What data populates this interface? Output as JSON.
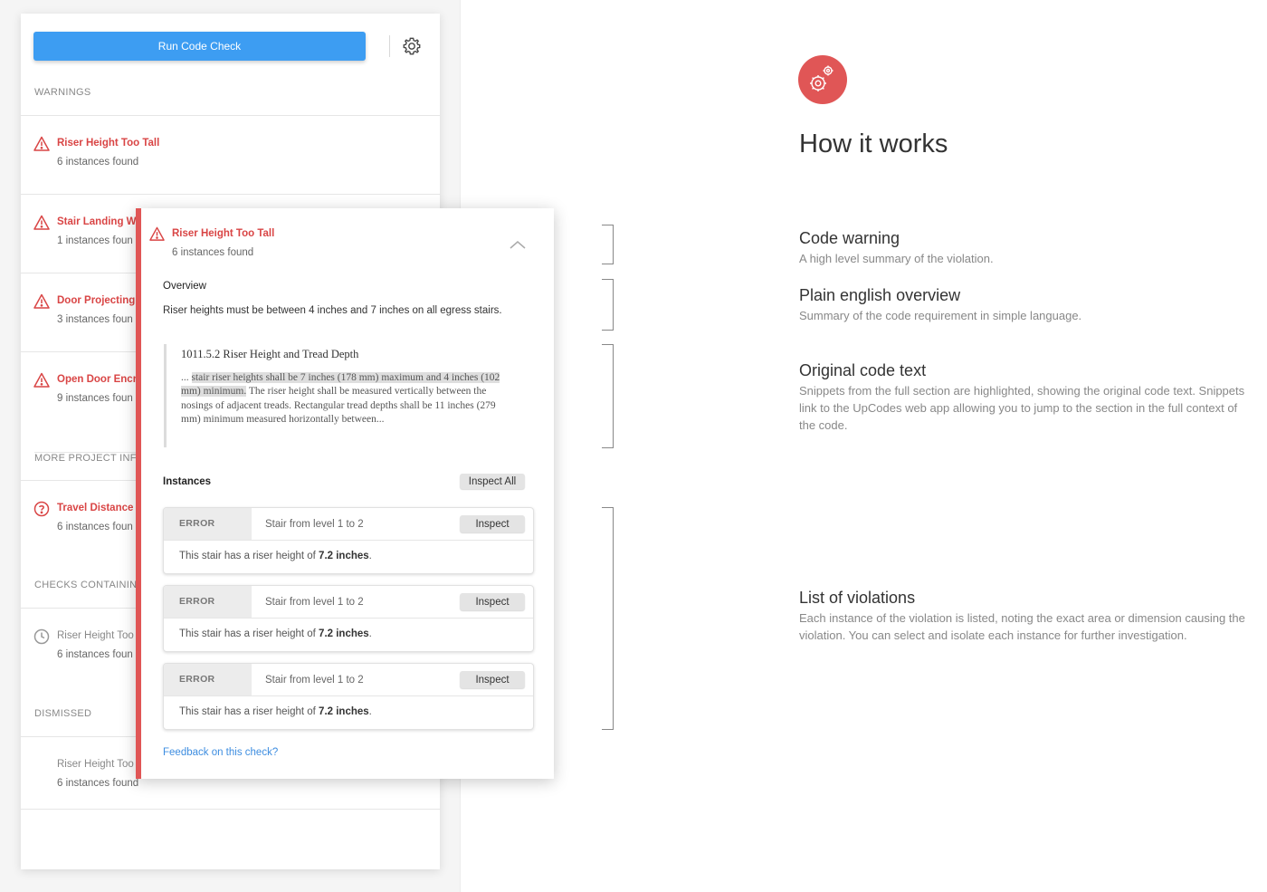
{
  "panel": {
    "run_button": "Run Code Check",
    "warnings_header": "WARNINGS",
    "warnings": [
      {
        "title": "Riser Height Too Tall",
        "count": "6 instances found"
      },
      {
        "title": "Stair Landing Wi",
        "count": "1 instances foun"
      },
      {
        "title": "Door Projecting",
        "count": "3 instances foun"
      },
      {
        "title": "Open Door Encro",
        "count": "9 instances foun"
      }
    ],
    "more_info_header": "MORE PROJECT INFO",
    "more_info_item": {
      "title": "Travel Distance",
      "count": "6 instances foun"
    },
    "checks_header": "CHECKS CONTAINING",
    "checks_item": {
      "title": "Riser Height Too",
      "count": "6 instances foun"
    },
    "dismissed_header": "DISMISSED",
    "dismissed_item": {
      "title": "Riser Height Too",
      "count": "6 instances found"
    }
  },
  "detail": {
    "title": "Riser Height Too Tall",
    "count": "6 instances found",
    "overview_label": "Overview",
    "overview_text": "Riser heights must be between 4 inches and 7 inches on all egress stairs.",
    "code_title": "1011.5.2 Riser Height and Tread Depth",
    "code_prefix": "... ",
    "code_highlight": "stair riser heights shall be 7 inches (178 mm) maximum and 4 inches (102 mm) minimum.",
    "code_rest": " The riser height shall be measured vertically between the nosings of adjacent treads. Rectangular tread depths shall be 11 inches (279 mm) minimum measured horizontally between...",
    "instances_label": "Instances",
    "inspect_all": "Inspect All",
    "instances": [
      {
        "type": "ERROR",
        "location": "Stair from level 1 to 2",
        "button": "Inspect",
        "msg_prefix": "This stair has a riser height of ",
        "msg_value": "7.2 inches",
        "msg_suffix": "."
      },
      {
        "type": "ERROR",
        "location": "Stair from level 1 to 2",
        "button": "Inspect",
        "msg_prefix": "This stair has a riser height of ",
        "msg_value": "7.2 inches",
        "msg_suffix": "."
      },
      {
        "type": "ERROR",
        "location": "Stair from level 1 to 2",
        "button": "Inspect",
        "msg_prefix": "This stair has a riser height of ",
        "msg_value": "7.2 inches",
        "msg_suffix": "."
      }
    ],
    "feedback_link": "Feedback on this check?"
  },
  "how": {
    "title": "How it works",
    "items": [
      {
        "title": "Code warning",
        "desc": "A high level summary of the violation."
      },
      {
        "title": "Plain english overview",
        "desc": "Summary of the code requirement in simple language."
      },
      {
        "title": "Original code text",
        "desc": "Snippets from the full section are highlighted, showing the original code text. Snippets link to the UpCodes web app allowing you to jump to the section in the full context of the code."
      },
      {
        "title": "List of violations",
        "desc": "Each instance of the violation is listed, noting the exact area or dimension causing the violation. You can select and isolate each instance for further investigation."
      }
    ]
  },
  "colors": {
    "primary_blue": "#3d9df2",
    "warning_red": "#d94545",
    "accent_red": "#e05656"
  },
  "icons": [
    "settings-gear-icon",
    "warning-triangle-icon",
    "question-circle-icon",
    "clock-icon",
    "chevron-up-icon",
    "gears-icon"
  ]
}
